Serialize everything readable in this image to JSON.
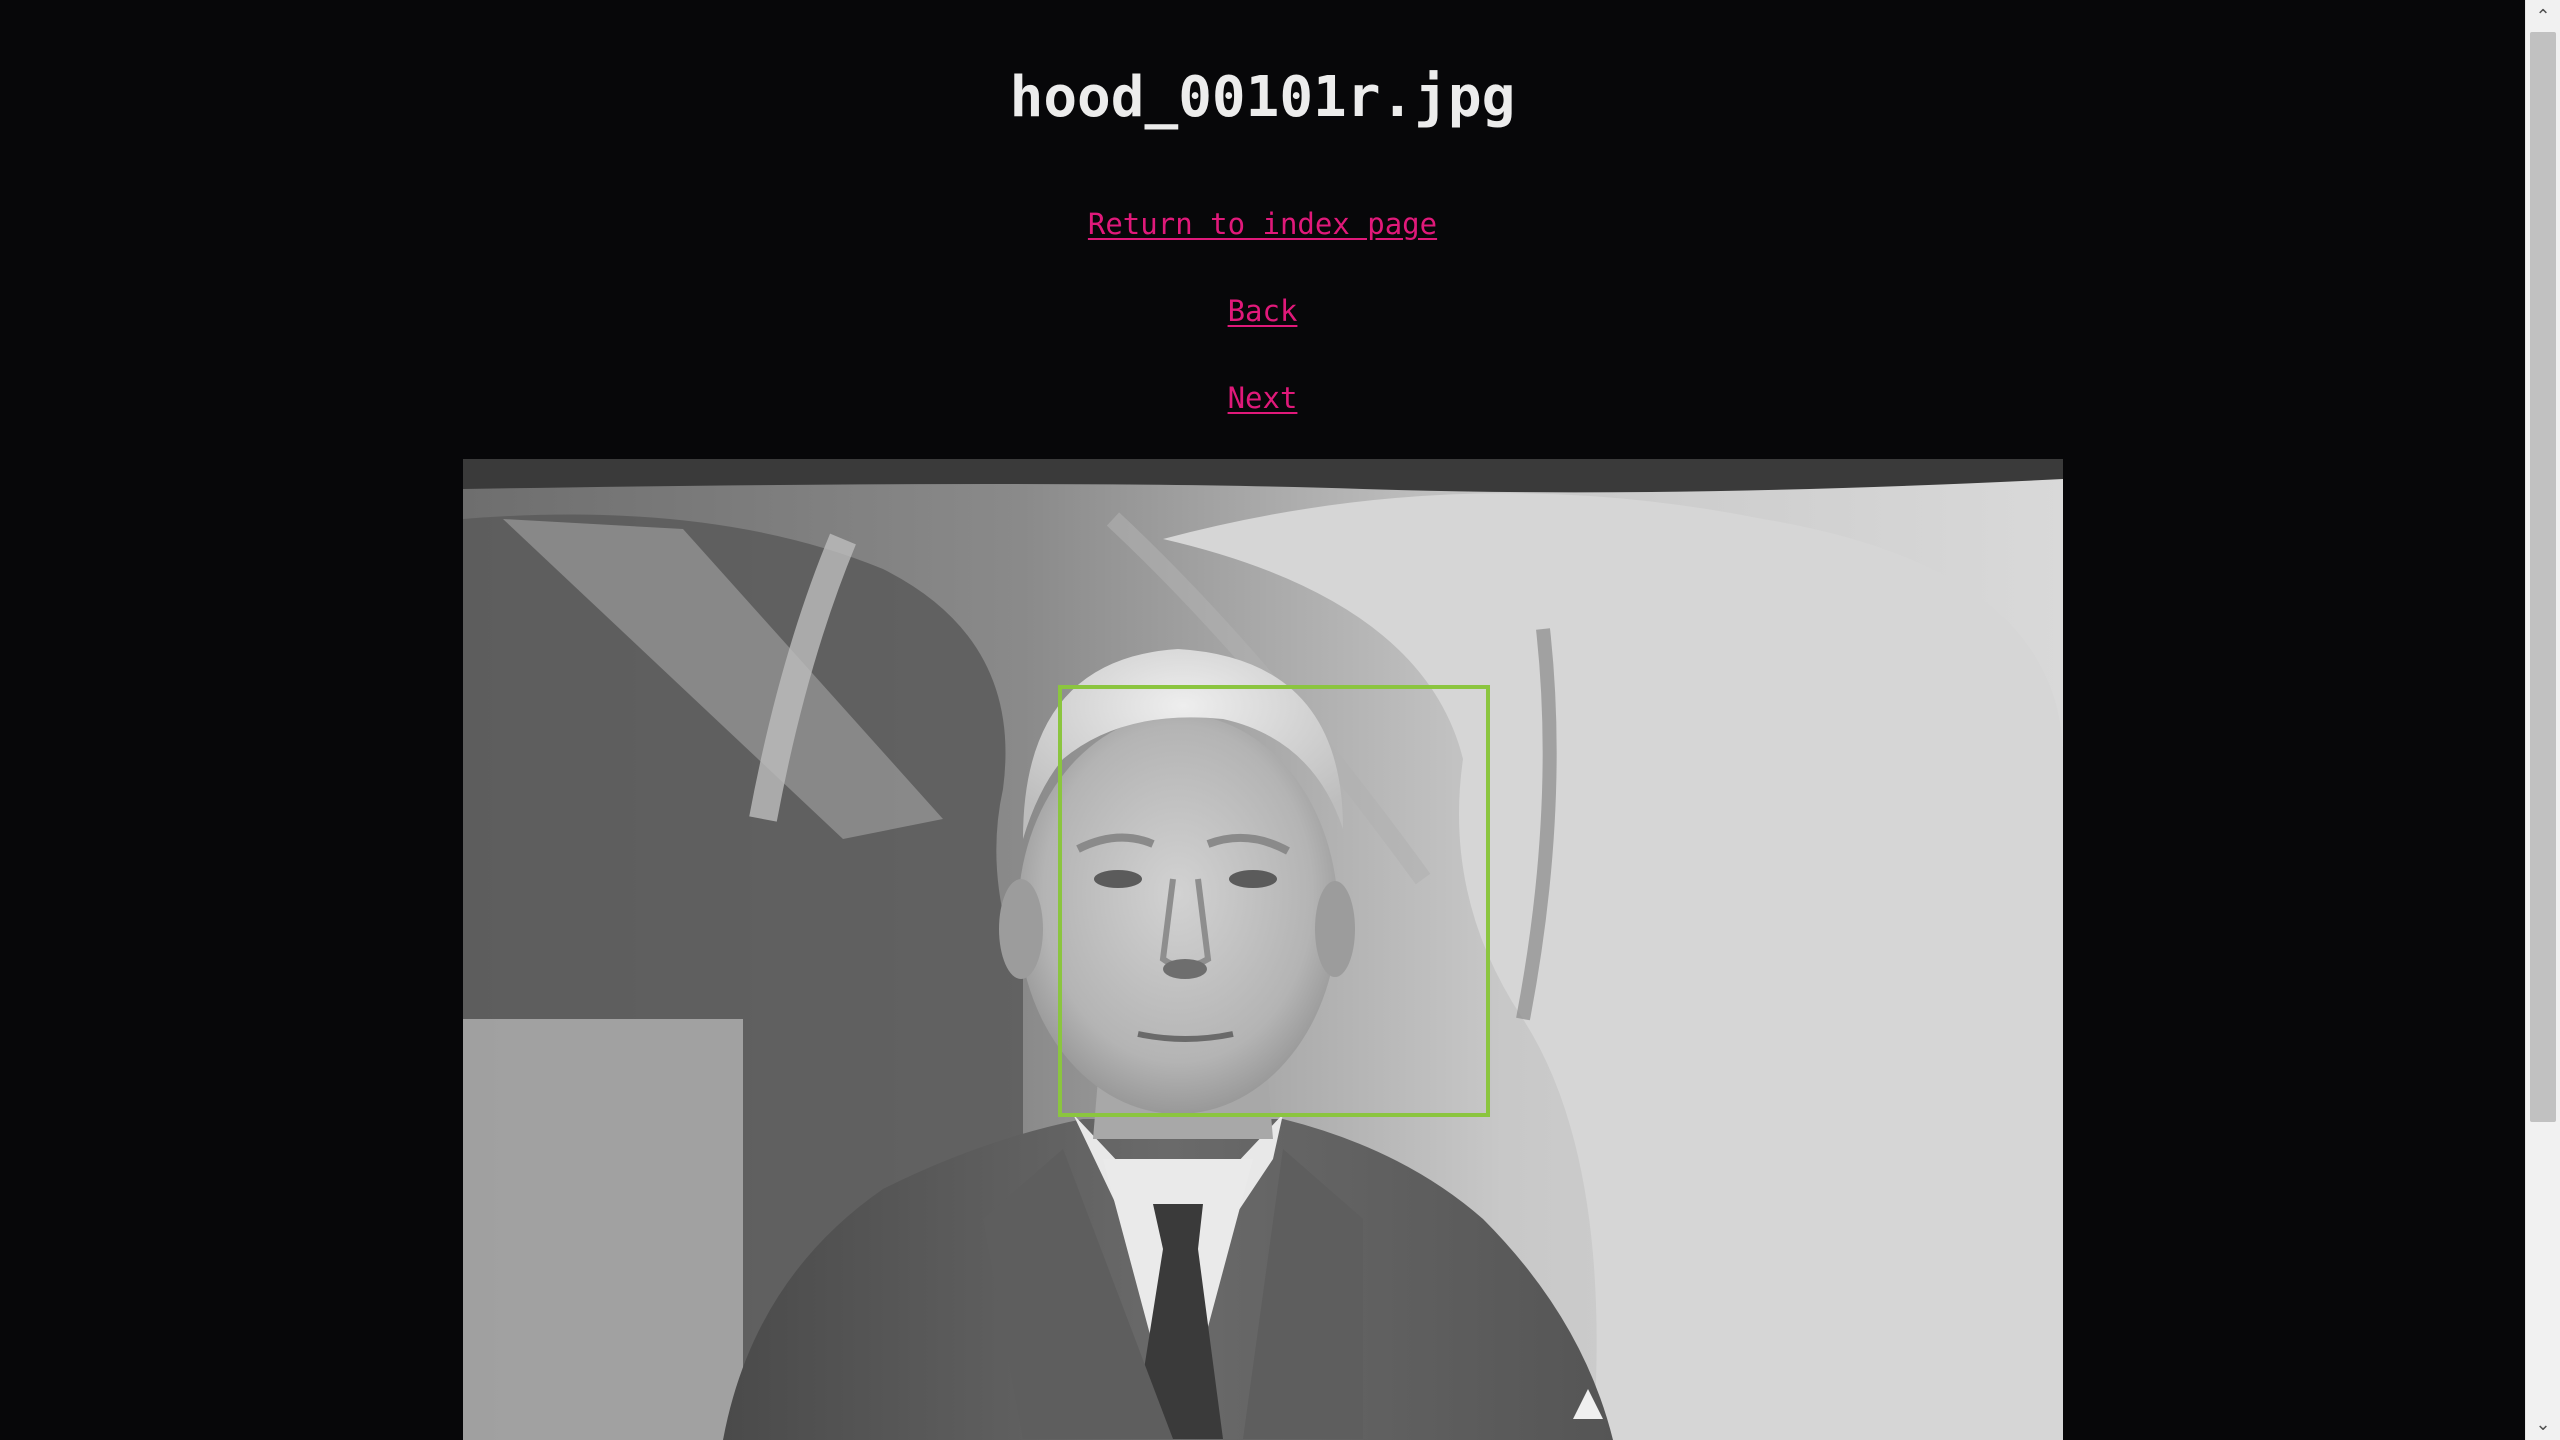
{
  "page": {
    "title": "hood_00101r.jpg"
  },
  "nav": {
    "index_label": "Return to index page",
    "back_label": "Back",
    "next_label": "Next"
  },
  "photo": {
    "description_icon": "photo-portrait",
    "detection_box_color": "#8bc53f"
  },
  "colors": {
    "background": "#070709",
    "title": "#ececec",
    "link": "#e0197a"
  },
  "scrollbar": {
    "up_icon": "chevron-up-icon",
    "down_icon": "chevron-down-icon"
  }
}
